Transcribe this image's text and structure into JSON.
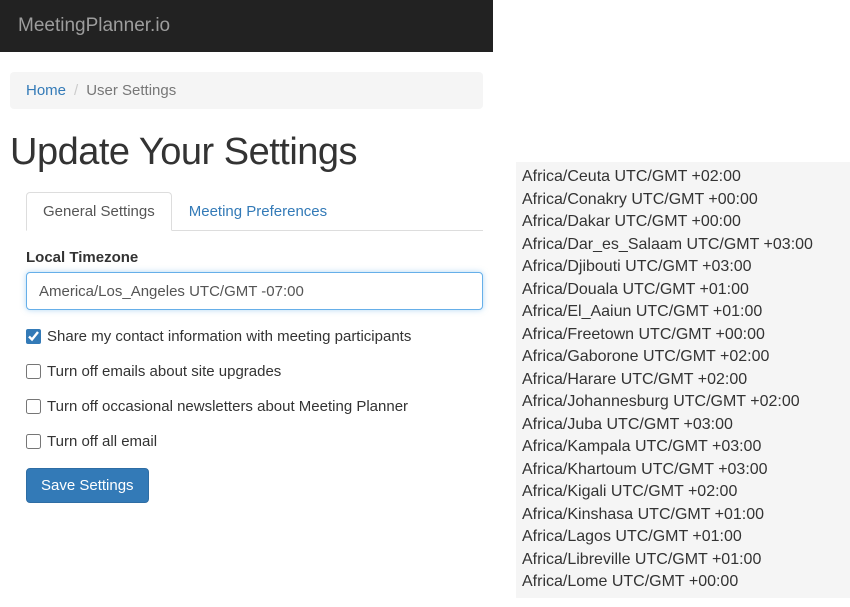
{
  "navbar": {
    "brand": "MeetingPlanner.io"
  },
  "breadcrumb": {
    "home": "Home",
    "current": "User Settings"
  },
  "page": {
    "title": "Update Your Settings"
  },
  "tabs": {
    "general": "General Settings",
    "preferences": "Meeting Preferences"
  },
  "form": {
    "timezone_label": "Local Timezone",
    "timezone_value": "America/Los_Angeles UTC/GMT -07:00",
    "share_contact": "Share my contact information with meeting participants",
    "turnoff_upgrades": "Turn off emails about site upgrades",
    "turnoff_newsletters": "Turn off occasional newsletters about Meeting Planner",
    "turnoff_all": "Turn off all email",
    "save_button": "Save Settings"
  },
  "timezone_options": [
    "Africa/Ceuta UTC/GMT +02:00",
    "Africa/Conakry UTC/GMT +00:00",
    "Africa/Dakar UTC/GMT +00:00",
    "Africa/Dar_es_Salaam UTC/GMT +03:00",
    "Africa/Djibouti UTC/GMT +03:00",
    "Africa/Douala UTC/GMT +01:00",
    "Africa/El_Aaiun UTC/GMT +01:00",
    "Africa/Freetown UTC/GMT +00:00",
    "Africa/Gaborone UTC/GMT +02:00",
    "Africa/Harare UTC/GMT +02:00",
    "Africa/Johannesburg UTC/GMT +02:00",
    "Africa/Juba UTC/GMT +03:00",
    "Africa/Kampala UTC/GMT +03:00",
    "Africa/Khartoum UTC/GMT +03:00",
    "Africa/Kigali UTC/GMT +02:00",
    "Africa/Kinshasa UTC/GMT +01:00",
    "Africa/Lagos UTC/GMT +01:00",
    "Africa/Libreville UTC/GMT +01:00",
    "Africa/Lome UTC/GMT +00:00"
  ]
}
